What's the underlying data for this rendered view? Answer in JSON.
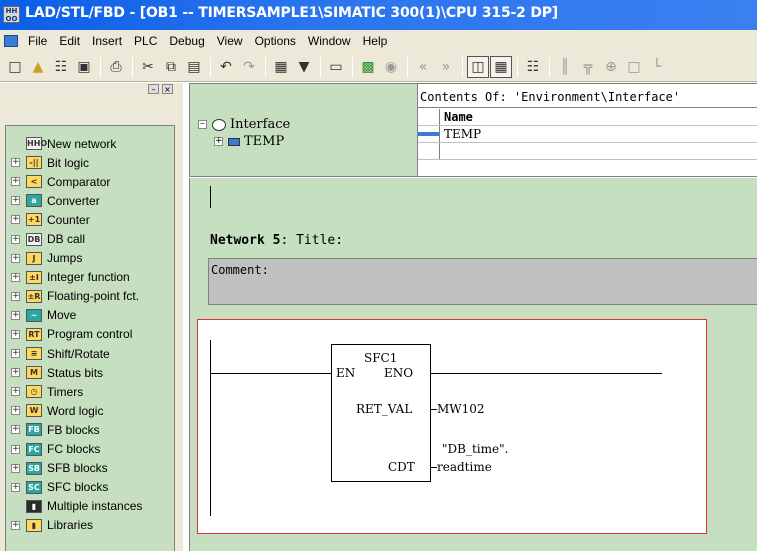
{
  "window": {
    "title": "LAD/STL/FBD  - [OB1 -- TIMERSAMPLE1\\SIMATIC 300(1)\\CPU 315-2 DP]"
  },
  "menu": [
    "File",
    "Edit",
    "Insert",
    "PLC",
    "Debug",
    "View",
    "Options",
    "Window",
    "Help"
  ],
  "toolbar": {
    "icons": [
      "new-icon",
      "open-icon",
      "network-icon",
      "save-icon",
      "print-icon",
      "cut-icon",
      "copy-icon",
      "paste-icon",
      "undo-icon",
      "redo-icon",
      "monitor-icon",
      "download-icon",
      "insert-icon",
      "accessible-icon",
      "online-icon",
      "prev-icon",
      "next-icon",
      "overview-icon",
      "detail-icon",
      "new-network-icon",
      "no-contact-icon",
      "nc-contact-icon",
      "coil-icon",
      "box-icon",
      "branch-icon"
    ]
  },
  "catalog": {
    "items": [
      {
        "label": "New network",
        "expandable": false,
        "icon": "new-network-icon",
        "glyph": "HHO"
      },
      {
        "label": "Bit logic",
        "expandable": true,
        "icon": "bit-logic-icon",
        "glyph": "-||"
      },
      {
        "label": "Comparator",
        "expandable": true,
        "icon": "comparator-icon",
        "glyph": "<"
      },
      {
        "label": "Converter",
        "expandable": true,
        "icon": "converter-icon",
        "glyph": "a"
      },
      {
        "label": "Counter",
        "expandable": true,
        "icon": "counter-icon",
        "glyph": "+1"
      },
      {
        "label": "DB call",
        "expandable": true,
        "icon": "db-call-icon",
        "glyph": "DB"
      },
      {
        "label": "Jumps",
        "expandable": true,
        "icon": "jumps-icon",
        "glyph": "J"
      },
      {
        "label": "Integer function",
        "expandable": true,
        "icon": "integer-function-icon",
        "glyph": "±I"
      },
      {
        "label": "Floating-point fct.",
        "expandable": true,
        "icon": "floating-point-icon",
        "glyph": "±R"
      },
      {
        "label": "Move",
        "expandable": true,
        "icon": "move-icon",
        "glyph": "~"
      },
      {
        "label": "Program control",
        "expandable": true,
        "icon": "program-control-icon",
        "glyph": "RT"
      },
      {
        "label": "Shift/Rotate",
        "expandable": true,
        "icon": "shift-rotate-icon",
        "glyph": "≡"
      },
      {
        "label": "Status bits",
        "expandable": true,
        "icon": "status-bits-icon",
        "glyph": "M"
      },
      {
        "label": "Timers",
        "expandable": true,
        "icon": "timers-icon",
        "glyph": "◷"
      },
      {
        "label": "Word logic",
        "expandable": true,
        "icon": "word-logic-icon",
        "glyph": "W"
      },
      {
        "label": "FB blocks",
        "expandable": true,
        "icon": "fb-blocks-icon",
        "glyph": "FB"
      },
      {
        "label": "FC blocks",
        "expandable": true,
        "icon": "fc-blocks-icon",
        "glyph": "FC"
      },
      {
        "label": "SFB blocks",
        "expandable": true,
        "icon": "sfb-blocks-icon",
        "glyph": "SB"
      },
      {
        "label": "SFC blocks",
        "expandable": true,
        "icon": "sfc-blocks-icon",
        "glyph": "SC"
      },
      {
        "label": "Multiple instances",
        "expandable": false,
        "icon": "multiple-instances-icon",
        "glyph": "▮"
      },
      {
        "label": "Libraries",
        "expandable": true,
        "icon": "libraries-icon",
        "glyph": "▮"
      }
    ]
  },
  "interface": {
    "tree_root": "Interface",
    "tree_child": "TEMP",
    "contents_label": "Contents Of: 'Environment\\Interface'",
    "column_name": "Name",
    "rows": [
      "TEMP",
      ""
    ]
  },
  "network": {
    "number_label": "Network 5",
    "title_label": ": Title:",
    "comment_label": "Comment:",
    "block_name": "SFC1",
    "en": "EN",
    "eno": "ENO",
    "ret_val": "RET_VAL",
    "ret_val_operand": "MW102",
    "cdt": "CDT",
    "cdt_operand_1": "\"DB_time\".",
    "cdt_operand_2": "readtime"
  },
  "colors": {
    "panel_green": "#c6dfc0",
    "titlebar_blue": "#0a5ee8",
    "highlight_red": "#d33333"
  }
}
